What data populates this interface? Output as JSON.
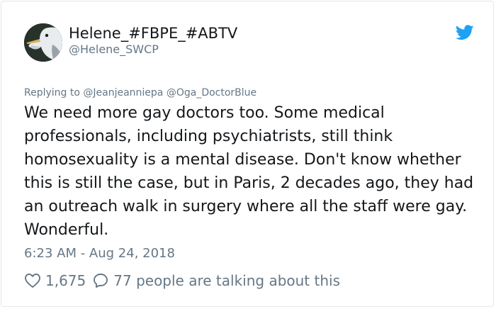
{
  "user": {
    "display_name": "Helene_#FBPE_#ABTV",
    "handle": "@Helene_SWCP"
  },
  "reply": {
    "prefix": "Replying to",
    "mentions": [
      "@Jeanjeanniepa",
      "@Oga_DoctorBlue"
    ]
  },
  "tweet": {
    "text": "We need more gay doctors too. Some medical professionals, including psychiatrists, still think homosexuality is a mental disease. Don't know whether this is still the case, but in Paris, 2 decades ago, they had an outreach walk in surgery where all the staff were gay. Wonderful.",
    "timestamp": "6:23 AM - Aug 24, 2018"
  },
  "actions": {
    "likes": "1,675",
    "talking": "77 people are talking about this",
    "like_icon": "heart-icon",
    "reply_icon": "speech-bubble-icon"
  },
  "colors": {
    "text": "#14171a",
    "secondary": "#657786",
    "twitter_blue": "#1da1f2",
    "border": "#e1e8ed"
  }
}
